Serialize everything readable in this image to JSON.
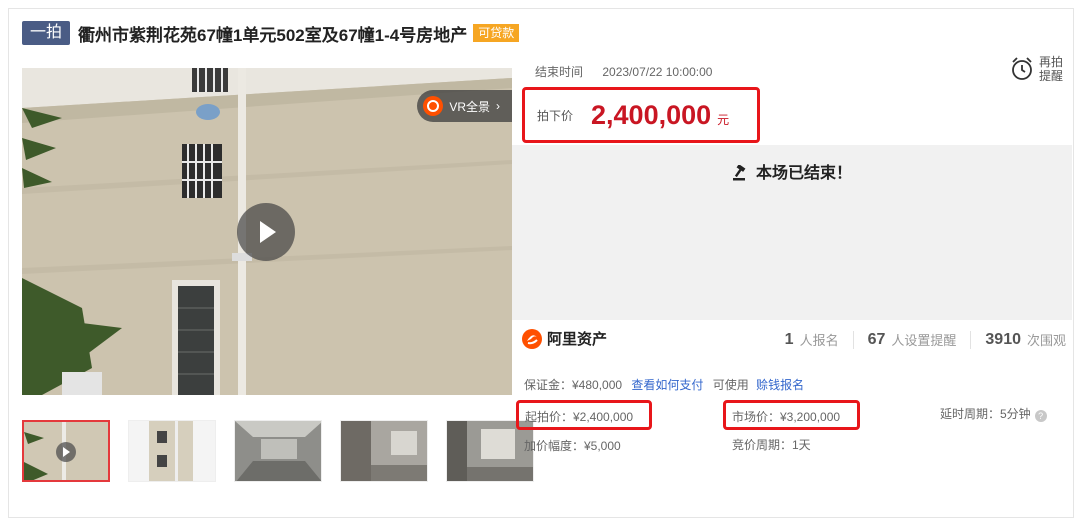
{
  "header": {
    "round_tag": "一拍",
    "title": "衢州市紫荆花苑67幢1单元502室及67幢1-4号房地产",
    "loan_tag": "可贷款"
  },
  "media": {
    "vr_label": "VR全景",
    "vr_chevron": "›",
    "thumbnails": [
      "video-cover",
      "building-exterior",
      "interior-room-1",
      "interior-room-2",
      "interior-room-3"
    ]
  },
  "auction": {
    "end_time_label": "结束时间",
    "end_time_value": "2023/07/22 10:00:00",
    "remind_label": "再拍提醒",
    "sold_label": "拍下价",
    "sold_price": "2,400,000",
    "sold_unit": "元",
    "status": "本场已结束！"
  },
  "brand": {
    "name": "阿里资产"
  },
  "stats": {
    "signups": "1",
    "signups_label": "人报名",
    "reminders": "67",
    "reminders_label": "人设置提醒",
    "views": "3910",
    "views_label": "次围观"
  },
  "details": {
    "deposit": "保证金：¥480,000",
    "deposit_link": "查看如何支付",
    "loan_prefix": "可使用",
    "loan_link": "赊钱报名",
    "start_price": "起拍价：¥2,400,000",
    "market_price": "市场价：¥3,200,000",
    "delay_period": "延时周期：5分钟",
    "increment": "加价幅度：¥5,000",
    "bid_period": "竞价周期：1天"
  },
  "colors": {
    "accent_red": "#c91623",
    "highlight_box": "#e8161a",
    "round_tag_bg": "#4a5c85",
    "loan_tag_bg": "#f6a623",
    "link": "#3366cc",
    "brand_orange": "#ff5000"
  }
}
